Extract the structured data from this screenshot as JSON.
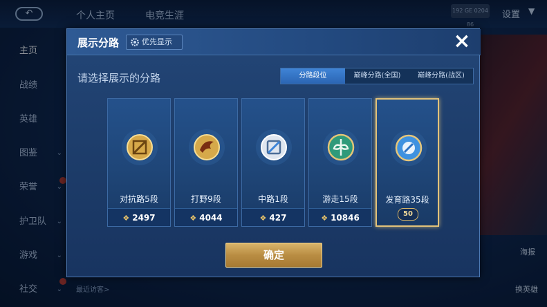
{
  "background": {
    "top_tabs": [
      "个人主页",
      "电竞生涯"
    ],
    "settings_label": "设置",
    "top_badge": "192 GE 0204 86",
    "sidebar": [
      {
        "label": "主页",
        "active": true
      },
      {
        "label": "战绩"
      },
      {
        "label": "英雄"
      },
      {
        "label": "图鉴"
      },
      {
        "label": "荣誉"
      },
      {
        "label": "护卫队"
      },
      {
        "label": "游戏"
      },
      {
        "label": "社交"
      }
    ],
    "recent_visitors": "最近访客>",
    "right_labels": {
      "poster": "海报",
      "swap_hero": "换英雄"
    }
  },
  "modal": {
    "title": "展示分路",
    "priority_button": "优先显示",
    "close_icon": "×",
    "subtitle": "请选择展示的分路",
    "tabs": [
      {
        "label": "分路段位",
        "active": true
      },
      {
        "label": "巅峰分路(全国)",
        "active": false
      },
      {
        "label": "巅峰分路(战区)",
        "active": false
      }
    ],
    "cards": [
      {
        "label": "对抗路5段",
        "score": "2497",
        "icon": "clash-lane-emblem-icon",
        "selected": false
      },
      {
        "label": "打野9段",
        "score": "4044",
        "icon": "jungle-emblem-icon",
        "selected": false
      },
      {
        "label": "中路1段",
        "score": "427",
        "icon": "mid-lane-emblem-icon",
        "selected": false
      },
      {
        "label": "游走15段",
        "score": "10846",
        "icon": "roam-emblem-icon",
        "selected": false
      },
      {
        "label": "发育路35段",
        "score": "50",
        "icon": "farm-lane-emblem-icon",
        "selected": true
      }
    ],
    "confirm_button": "确定"
  },
  "colors": {
    "accent_blue": "#3f84d6",
    "gold": "#e2c27a",
    "modal_bg": "#1f4273"
  }
}
